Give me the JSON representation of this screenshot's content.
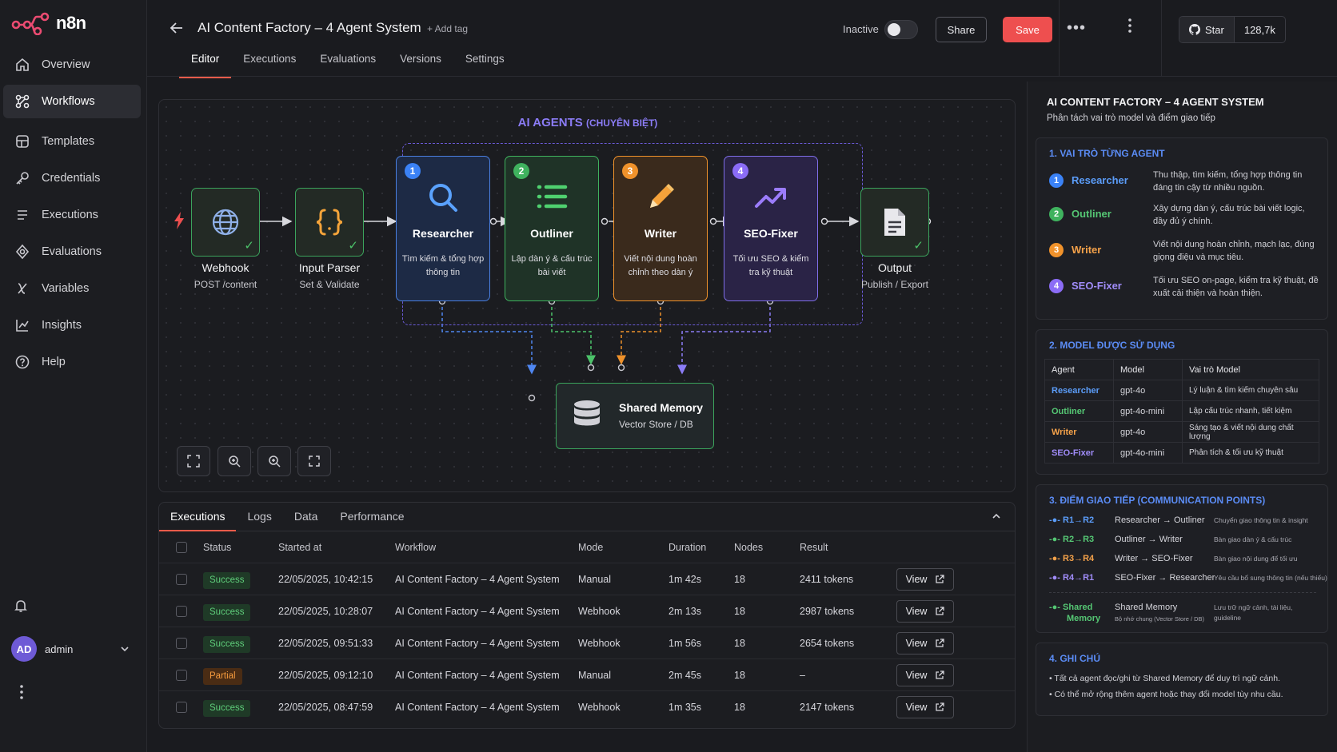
{
  "app": {
    "logo_text": "n8n"
  },
  "sidebar": {
    "items": [
      {
        "label": "Overview",
        "icon": "home-icon"
      },
      {
        "label": "Workflows",
        "icon": "workflows-icon"
      },
      {
        "label": "Templates",
        "icon": "templates-icon"
      },
      {
        "label": "Credentials",
        "icon": "key-icon"
      },
      {
        "label": "Executions",
        "icon": "list-icon"
      },
      {
        "label": "Evaluations",
        "icon": "evaluations-icon"
      },
      {
        "label": "Variables",
        "icon": "variable-icon"
      },
      {
        "label": "Insights",
        "icon": "chart-icon"
      },
      {
        "label": "Help",
        "icon": "help-icon"
      }
    ],
    "active": "Workflows",
    "user": {
      "initials": "AD",
      "name": "admin"
    }
  },
  "header": {
    "title": "AI Content Factory – 4 Agent System",
    "add_tag": "+ Add tag",
    "status_label": "Inactive",
    "share_label": "Share",
    "save_label": "Save",
    "star_label": "Star",
    "star_count": "128,7k",
    "tabs": [
      "Editor",
      "Executions",
      "Evaluations",
      "Versions",
      "Settings"
    ],
    "active_tab": "Editor"
  },
  "canvas": {
    "group_title": "AI AGENTS",
    "group_subtitle": "(CHUYÊN BIỆT)",
    "webhook": {
      "title": "Webhook",
      "subtitle": "POST /content"
    },
    "parser": {
      "title": "Input Parser",
      "subtitle": "Set & Validate"
    },
    "output": {
      "title": "Output",
      "subtitle": "Publish / Export"
    },
    "agents": [
      {
        "num": "1",
        "name": "Researcher",
        "desc": "Tìm kiếm & tổng hợp thông tin",
        "color": "#3b82f6"
      },
      {
        "num": "2",
        "name": "Outliner",
        "desc": "Lập dàn ý & cấu trúc bài viết",
        "color": "#3fb25e"
      },
      {
        "num": "3",
        "name": "Writer",
        "desc": "Viết nội dung hoàn chỉnh theo dàn ý",
        "color": "#f0922b"
      },
      {
        "num": "4",
        "name": "SEO-Fixer",
        "desc": "Tối ưu SEO & kiểm tra kỹ thuật",
        "color": "#8b6cf6"
      }
    ],
    "memory": {
      "title": "Shared Memory",
      "subtitle": "Vector Store / DB"
    }
  },
  "panel": {
    "tabs": [
      "Executions",
      "Logs",
      "Data",
      "Performance"
    ],
    "active_tab": "Executions",
    "columns": [
      "Status",
      "Started at",
      "Workflow",
      "Mode",
      "Duration",
      "Nodes",
      "Result"
    ],
    "view_label": "View",
    "rows": [
      {
        "status": "Success",
        "started": "22/05/2025, 10:42:15",
        "workflow": "AI Content Factory – 4 Agent System",
        "mode": "Manual",
        "duration": "1m 42s",
        "nodes": "18",
        "result": "2411 tokens"
      },
      {
        "status": "Success",
        "started": "22/05/2025, 10:28:07",
        "workflow": "AI Content Factory – 4 Agent System",
        "mode": "Webhook",
        "duration": "2m 13s",
        "nodes": "18",
        "result": "2987 tokens"
      },
      {
        "status": "Success",
        "started": "22/05/2025, 09:51:33",
        "workflow": "AI Content Factory – 4 Agent System",
        "mode": "Webhook",
        "duration": "1m 56s",
        "nodes": "18",
        "result": "2654 tokens"
      },
      {
        "status": "Partial",
        "started": "22/05/2025, 09:12:10",
        "workflow": "AI Content Factory – 4 Agent System",
        "mode": "Manual",
        "duration": "2m 45s",
        "nodes": "18",
        "result": "–"
      },
      {
        "status": "Success",
        "started": "22/05/2025, 08:47:59",
        "workflow": "AI Content Factory – 4 Agent System",
        "mode": "Webhook",
        "duration": "1m 35s",
        "nodes": "18",
        "result": "2147 tokens"
      }
    ]
  },
  "info": {
    "title": "AI CONTENT FACTORY – 4 AGENT SYSTEM",
    "subtitle": "Phân tách vai trò model và điểm giao tiếp",
    "roles_heading": "1. VAI TRÒ TỪNG AGENT",
    "roles": [
      {
        "num": "1",
        "name": "Researcher",
        "desc": "Thu thập, tìm kiếm, tổng hợp thông tin đáng tin cậy từ nhiều nguồn.",
        "color": "#3b82f6",
        "text_color": "#5b9cf8"
      },
      {
        "num": "2",
        "name": "Outliner",
        "desc": "Xây dựng dàn ý, cấu trúc bài viết logic, đầy đủ ý chính.",
        "color": "#3fb25e",
        "text_color": "#55c774"
      },
      {
        "num": "3",
        "name": "Writer",
        "desc": "Viết nội dung hoàn chỉnh, mạch lạc, đúng giọng điệu và mục tiêu.",
        "color": "#f0922b",
        "text_color": "#f5a24a"
      },
      {
        "num": "4",
        "name": "SEO-Fixer",
        "desc": "Tối ưu SEO on-page, kiểm tra kỹ thuật, đề xuất cải thiện và hoàn thiện.",
        "color": "#8b6cf6",
        "text_color": "#a08cf9"
      }
    ],
    "models_heading": "2. MODEL ĐƯỢC SỬ DỤNG",
    "model_columns": [
      "Agent",
      "Model",
      "Vai trò Model"
    ],
    "models": [
      {
        "agent": "Researcher",
        "model": "gpt-4o",
        "role": "Lý luận & tìm kiếm chuyên sâu",
        "color": "#5b9cf8"
      },
      {
        "agent": "Outliner",
        "model": "gpt-4o-mini",
        "role": "Lập cấu trúc nhanh, tiết kiệm",
        "color": "#55c774"
      },
      {
        "agent": "Writer",
        "model": "gpt-4o",
        "role": "Sáng tạo & viết nội dung chất lượng",
        "color": "#f5a24a"
      },
      {
        "agent": "SEO-Fixer",
        "model": "gpt-4o-mini",
        "role": "Phân tích & tối ưu kỹ thuật",
        "color": "#a08cf9"
      }
    ],
    "comm_heading": "3. ĐIỂM GIAO TIẾP (COMMUNICATION POINTS)",
    "comms": [
      {
        "key": "R1→R2",
        "label": "Researcher → Outliner",
        "desc": "Chuyển giao thông tin & insight",
        "color": "#5b9cf8"
      },
      {
        "key": "R2→R3",
        "label": "Outliner → Writer",
        "desc": "Bàn giao dàn ý & cấu trúc",
        "color": "#55c774"
      },
      {
        "key": "R3→R4",
        "label": "Writer → SEO-Fixer",
        "desc": "Bàn giao nội dung để tối ưu",
        "color": "#f5a24a"
      },
      {
        "key": "R4→R1",
        "label": "SEO-Fixer → Researcher",
        "desc": "Yêu cầu bổ sung thông tin (nếu thiếu)",
        "color": "#a08cf9"
      }
    ],
    "memory_row": {
      "key_line1": "Shared",
      "key_line2": "Memory",
      "label": "Shared Memory",
      "sublabel": "Bộ nhớ chung (Vector Store / DB)",
      "desc_line1": "Lưu trữ ngữ cảnh, tài liệu,",
      "desc_line2": "guideline",
      "color": "#55c774"
    },
    "notes_heading": "4. GHI CHÚ",
    "notes": [
      "Tất cả agent đọc/ghi từ Shared Memory để duy trì ngữ cảnh.",
      "Có thể mở rộng thêm agent hoặc thay đổi model tùy nhu cầu."
    ]
  }
}
